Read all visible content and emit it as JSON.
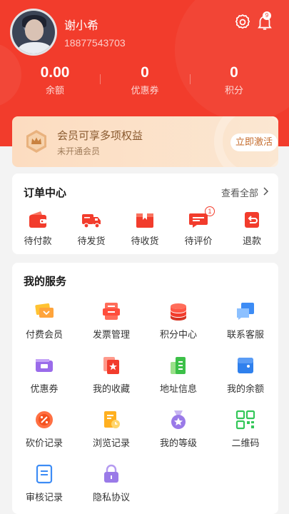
{
  "profile": {
    "username": "谢小希",
    "phone": "18877543703",
    "notification_count": "9"
  },
  "stats": [
    {
      "value": "0.00",
      "label": "余额"
    },
    {
      "value": "0",
      "label": "优惠券"
    },
    {
      "value": "0",
      "label": "积分"
    }
  ],
  "membership": {
    "title": "会员可享多项权益",
    "subtitle": "未开通会员",
    "button": "立即激活"
  },
  "orders": {
    "title": "订单中心",
    "view_all": "查看全部",
    "items": [
      {
        "label": "待付款",
        "icon": "wallet-icon"
      },
      {
        "label": "待发货",
        "icon": "truck-icon"
      },
      {
        "label": "待收货",
        "icon": "box-icon"
      },
      {
        "label": "待评价",
        "icon": "comment-icon",
        "badge": "1"
      },
      {
        "label": "退款",
        "icon": "refund-icon"
      }
    ]
  },
  "services": {
    "title": "我的服务",
    "items": [
      {
        "label": "付费会员",
        "icon": "vip-ticket-icon"
      },
      {
        "label": "发票管理",
        "icon": "invoice-icon"
      },
      {
        "label": "积分中心",
        "icon": "coin-stack-icon"
      },
      {
        "label": "联系客服",
        "icon": "chat-icon"
      },
      {
        "label": "优惠券",
        "icon": "coupon-icon"
      },
      {
        "label": "我的收藏",
        "icon": "favorite-icon"
      },
      {
        "label": "地址信息",
        "icon": "address-icon"
      },
      {
        "label": "我的余额",
        "icon": "balance-icon"
      },
      {
        "label": "砍价记录",
        "icon": "bargain-icon"
      },
      {
        "label": "浏览记录",
        "icon": "history-icon"
      },
      {
        "label": "我的等级",
        "icon": "medal-icon"
      },
      {
        "label": "二维码",
        "icon": "qrcode-icon"
      },
      {
        "label": "审核记录",
        "icon": "audit-icon"
      },
      {
        "label": "隐私协议",
        "icon": "lock-icon"
      }
    ]
  },
  "colors": {
    "primary": "#f23c2c",
    "member_text": "#8a5a2f"
  }
}
